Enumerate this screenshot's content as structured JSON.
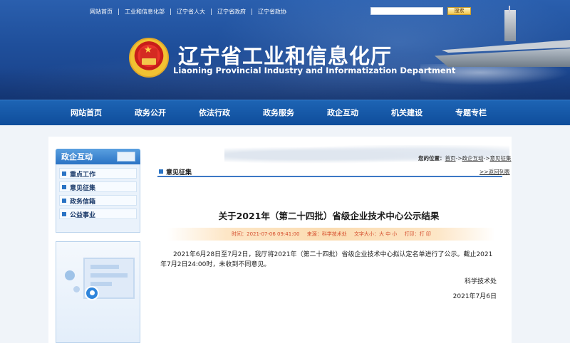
{
  "header": {
    "top_links": [
      "网站首页",
      "工业和信息化部",
      "辽宁省人大",
      "辽宁省政府",
      "辽宁省政协"
    ],
    "search_button": "搜索",
    "search_placeholder": "",
    "title_cn": "辽宁省工业和信息化厅",
    "title_en": "Liaoning Provincial Industry and Informatization Department"
  },
  "nav": {
    "items": [
      "网站首页",
      "政务公开",
      "依法行政",
      "政务服务",
      "政企互动",
      "机关建设",
      "专题专栏"
    ]
  },
  "sidebar": {
    "title": "政企互动",
    "items": [
      "重点工作",
      "意见征集",
      "政务信箱",
      "公益事业"
    ]
  },
  "breadcrumb": {
    "prefix": "您的位置：",
    "items": [
      "首页",
      "政企互动",
      "意见征集"
    ],
    "sep": "->"
  },
  "section": {
    "title": "意见征集",
    "back_link": ">>返回列表"
  },
  "article": {
    "title": "关于2021年（第二十四批）省级企业技术中心公示结果",
    "meta": {
      "time_label": "时间：",
      "time": "2021-07-06 09:41:00",
      "source_label": "来源：",
      "source": "科学技术处",
      "font_label": "文字大小：",
      "font_sizes": [
        "大",
        "中",
        "小"
      ],
      "print_label": "打印：",
      "print": "打 印"
    },
    "body": "2021年6月28日至7月2日，我厅将2021年（第二十四批）省级企业技术中心拟认定名单进行了公示。截止2021年7月2日24:00时，未收到不同意见。",
    "signature": "科学技术处",
    "date": "2021年7月6日"
  },
  "colors": {
    "nav_bg": "#1456a6",
    "accent": "#2a73c4",
    "meta_text": "#d44a2a"
  }
}
